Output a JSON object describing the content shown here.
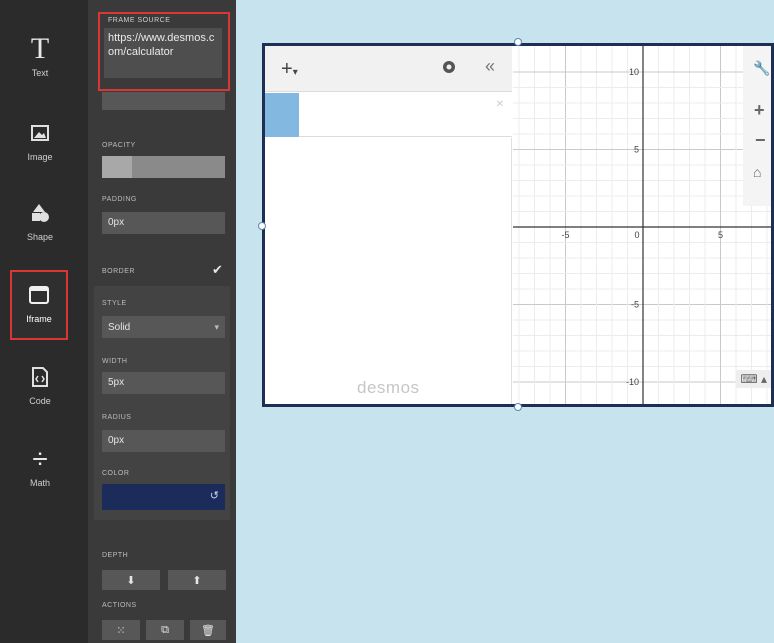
{
  "toolbar": {
    "items": [
      {
        "label": "Text",
        "icon": "text-icon"
      },
      {
        "label": "Image",
        "icon": "image-icon"
      },
      {
        "label": "Shape",
        "icon": "shape-icon"
      },
      {
        "label": "Iframe",
        "icon": "iframe-icon",
        "selected": true
      },
      {
        "label": "Code",
        "icon": "code-icon"
      },
      {
        "label": "Math",
        "icon": "math-icon"
      }
    ]
  },
  "panel": {
    "frame_source_label": "FRAME SOURCE",
    "frame_source_value": "https://www.desmos.com/calculator",
    "opacity_label": "OPACITY",
    "padding_label": "PADDING",
    "padding_value": "0px",
    "border_label": "BORDER",
    "style_label": "STYLE",
    "style_value": "Solid",
    "width_label": "WIDTH",
    "width_value": "5px",
    "radius_label": "RADIUS",
    "radius_value": "0px",
    "color_label": "COLOR",
    "color_value": "#1b2c5a",
    "depth_label": "DEPTH",
    "actions_label": "ACTIONS"
  },
  "desmos": {
    "logo_text": "desmos",
    "ticks_x": [
      "-5",
      "0",
      "5"
    ],
    "ticks_y": [
      "10",
      "5",
      "-5",
      "-10"
    ]
  },
  "colors": {
    "selection_highlight": "#d93636",
    "frame_border": "#1e2f55",
    "canvas_bg": "#c7e3ee"
  }
}
